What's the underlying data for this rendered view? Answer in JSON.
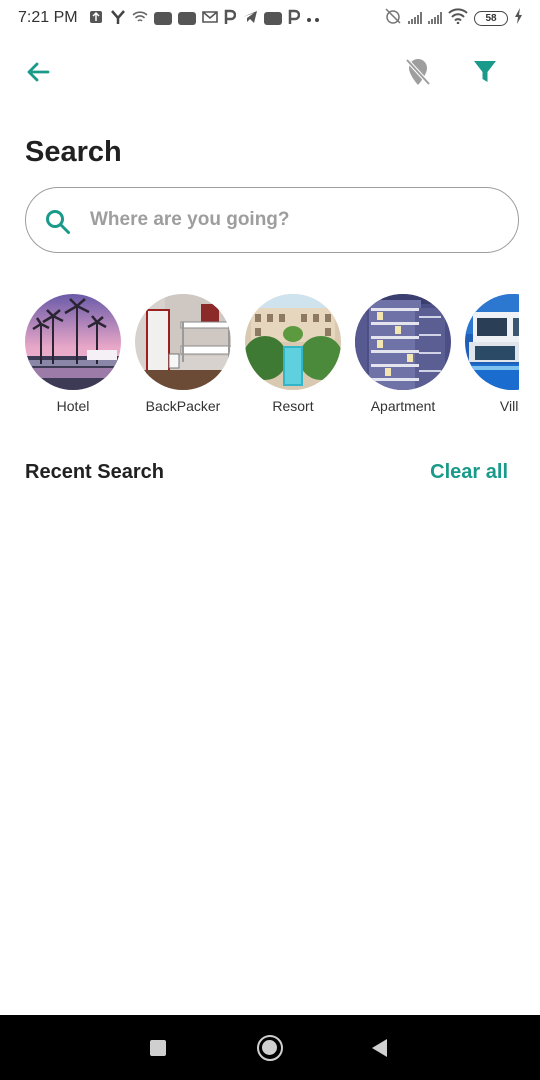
{
  "status_bar": {
    "time": "7:21 PM",
    "battery": "58",
    "left_icons": [
      "usb-icon",
      "y-app-icon",
      "wifi-small-icon",
      "youtube-icon",
      "youtube-icon",
      "gmail-icon",
      "p-app-icon",
      "telegram-icon",
      "youtube-icon",
      "p-app-icon",
      "more-dots-icon"
    ],
    "right_icons": [
      "alarm-off-icon",
      "signal-icon",
      "signal-icon",
      "wifi-icon",
      "battery-icon",
      "charging-icon"
    ]
  },
  "app_bar": {
    "back_icon": "arrow-back-icon",
    "map_icon": "location-off-icon",
    "filter_icon": "filter-icon"
  },
  "page": {
    "title": "Search"
  },
  "search": {
    "placeholder": "Where are you going?",
    "value": ""
  },
  "categories": [
    {
      "label": "Hotel"
    },
    {
      "label": "BackPacker"
    },
    {
      "label": "Resort"
    },
    {
      "label": "Apartment"
    },
    {
      "label": "Villa"
    }
  ],
  "recent": {
    "title": "Recent Search",
    "clear_label": "Clear all"
  },
  "colors": {
    "accent": "#1a9a8a",
    "icon_grey": "#9e9e9e",
    "text": "#212121"
  }
}
